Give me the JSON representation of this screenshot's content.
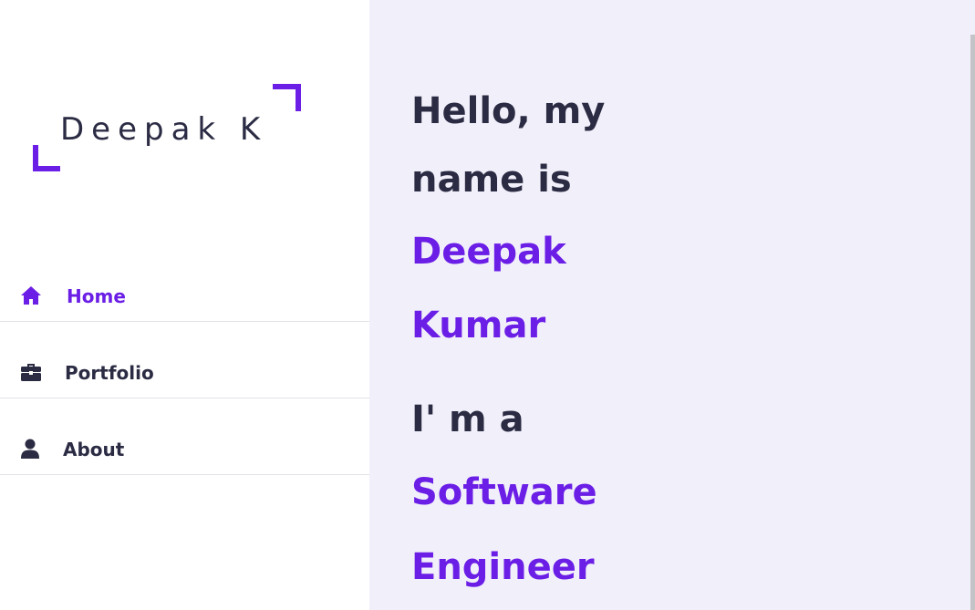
{
  "logo": {
    "text": "Deepak K"
  },
  "nav": {
    "items": [
      {
        "label": "Home",
        "icon": "home-icon",
        "active": true
      },
      {
        "label": "Portfolio",
        "icon": "briefcase-icon",
        "active": false
      },
      {
        "label": "About",
        "icon": "user-icon",
        "active": false
      }
    ]
  },
  "hero": {
    "line1": "Hello, my",
    "line2": "name is",
    "name_first": "Deepak",
    "name_last": "Kumar",
    "role_prefix": "I' m a",
    "role_line1": "Software",
    "role_line2": "Engineer"
  },
  "colors": {
    "accent": "#6b1ee6",
    "text_dark": "#2b2b44",
    "main_background": "#f1f0fa",
    "sidebar_background": "#ffffff"
  }
}
